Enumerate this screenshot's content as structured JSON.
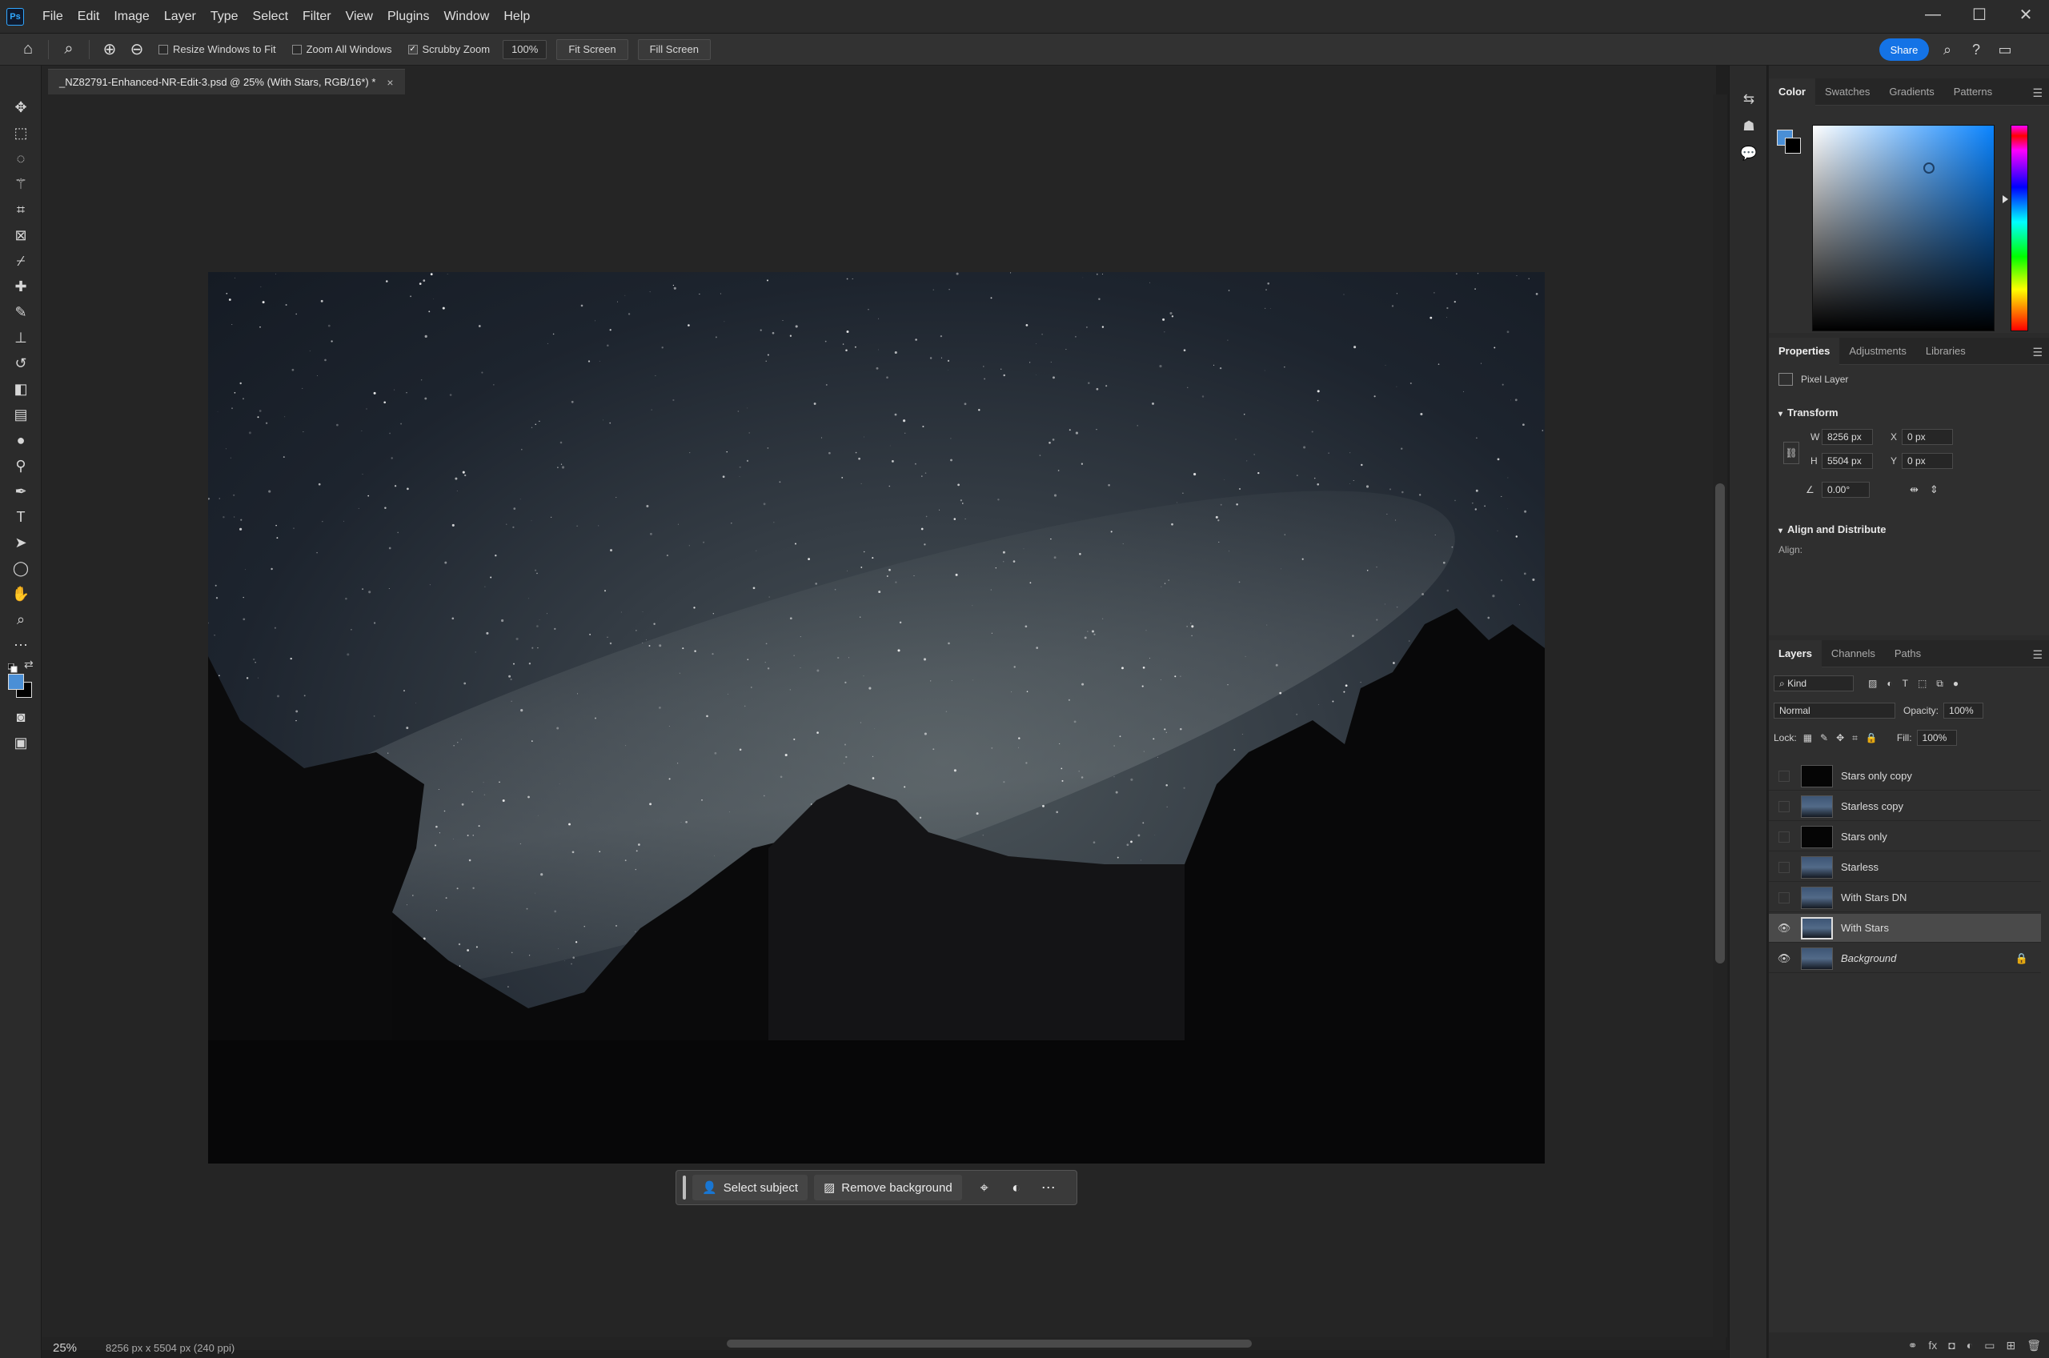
{
  "menubar": {
    "logo": "Ps",
    "items": [
      "File",
      "Edit",
      "Image",
      "Layer",
      "Type",
      "Select",
      "Filter",
      "View",
      "Plugins",
      "Window",
      "Help"
    ],
    "window_controls": {
      "minimize": "—",
      "maximize": "☐",
      "close": "✕"
    }
  },
  "options": {
    "resize_windows": "Resize Windows to Fit",
    "zoom_all": "Zoom All Windows",
    "scrubby_zoom": "Scrubby Zoom",
    "zoom_value": "100%",
    "fit_screen": "Fit Screen",
    "fill_screen": "Fill Screen",
    "share": "Share"
  },
  "document": {
    "tab_title": "_NZ82791-Enhanced-NR-Edit-3.psd @ 25% (With Stars, RGB/16*) *",
    "zoom_status": "25%",
    "info": "8256 px x 5504 px (240 ppi)"
  },
  "context_bar": {
    "select_subject": "Select subject",
    "remove_background": "Remove background"
  },
  "color_panel": {
    "tabs": [
      "Color",
      "Swatches",
      "Gradients",
      "Patterns"
    ],
    "foreground": "#4a8fd6",
    "background": "#000000"
  },
  "properties_panel": {
    "tabs": [
      "Properties",
      "Adjustments",
      "Libraries"
    ],
    "layer_type": "Pixel Layer",
    "transform_title": "Transform",
    "w_label": "W",
    "w_value": "8256 px",
    "h_label": "H",
    "h_value": "5504 px",
    "x_label": "X",
    "x_value": "0 px",
    "y_label": "Y",
    "y_value": "0 px",
    "angle": "0.00°",
    "align_title": "Align and Distribute",
    "align_label": "Align:"
  },
  "layers_panel": {
    "tabs": [
      "Layers",
      "Channels",
      "Paths"
    ],
    "kind_label": "Kind",
    "blend_mode": "Normal",
    "opacity_label": "Opacity:",
    "opacity_value": "100%",
    "lock_label": "Lock:",
    "fill_label": "Fill:",
    "fill_value": "100%",
    "layers": [
      {
        "name": "Stars only copy",
        "visible": false,
        "thumb": "dark"
      },
      {
        "name": "Starless copy",
        "visible": false,
        "thumb": "sky"
      },
      {
        "name": "Stars only",
        "visible": false,
        "thumb": "dark"
      },
      {
        "name": "Starless",
        "visible": false,
        "thumb": "sky"
      },
      {
        "name": "With Stars DN",
        "visible": false,
        "thumb": "sky"
      },
      {
        "name": "With Stars",
        "visible": true,
        "thumb": "sky",
        "selected": true
      },
      {
        "name": "Background",
        "visible": true,
        "thumb": "sky",
        "locked": true
      }
    ]
  }
}
